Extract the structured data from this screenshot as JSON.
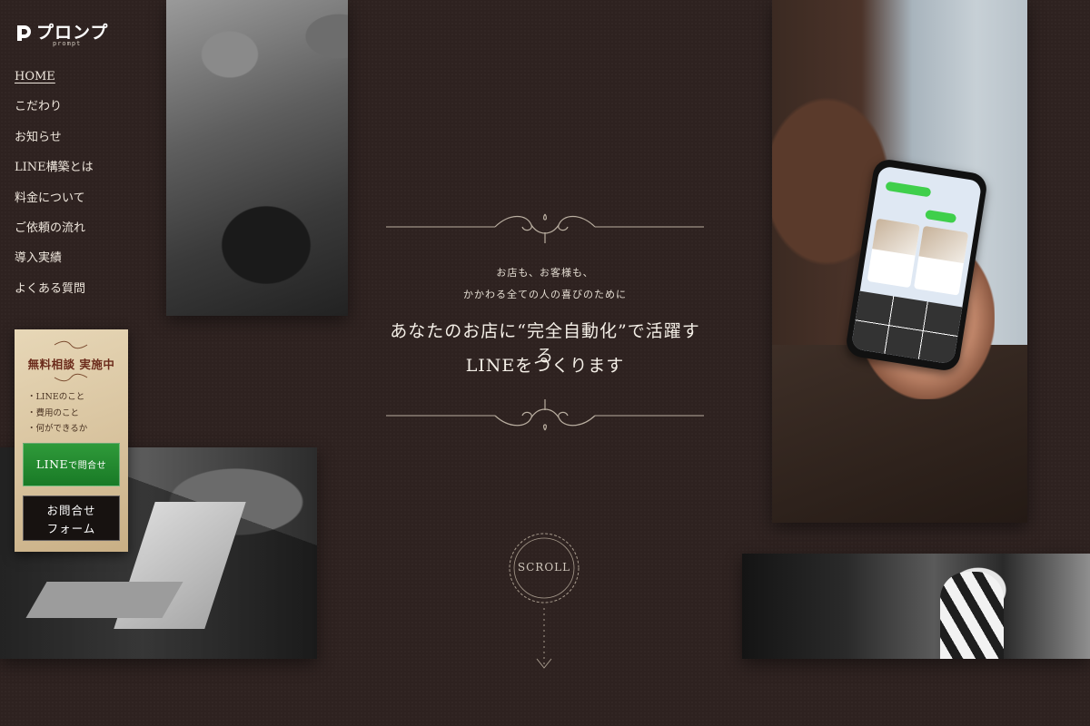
{
  "brand": {
    "name": "プロンプ",
    "sub": "prompt"
  },
  "nav": [
    {
      "label": "HOME",
      "active": true
    },
    {
      "label": "こだわり"
    },
    {
      "label": "お知らせ"
    },
    {
      "label": "LINE構築とは"
    },
    {
      "label": "料金について"
    },
    {
      "label": "ご依頼の流れ"
    },
    {
      "label": "導入実績"
    },
    {
      "label": "よくある質問"
    }
  ],
  "hero": {
    "sub1": "お店も、お客様も、",
    "sub2": "かかわる全ての人の喜びのために",
    "headline1": "あなたのお店に“完全自動化”で活躍する",
    "headline2": "LINEをつくります"
  },
  "scroll": {
    "label": "SCROLL"
  },
  "promo": {
    "title": "無料相談 実施中",
    "items": [
      "・LINEのこと",
      "・費用のこと",
      "・何ができるか"
    ],
    "line_button_main": "LINE",
    "line_button_small": "で問合せ",
    "form_button_line1": "お問合せ",
    "form_button_line2": "フォーム"
  }
}
